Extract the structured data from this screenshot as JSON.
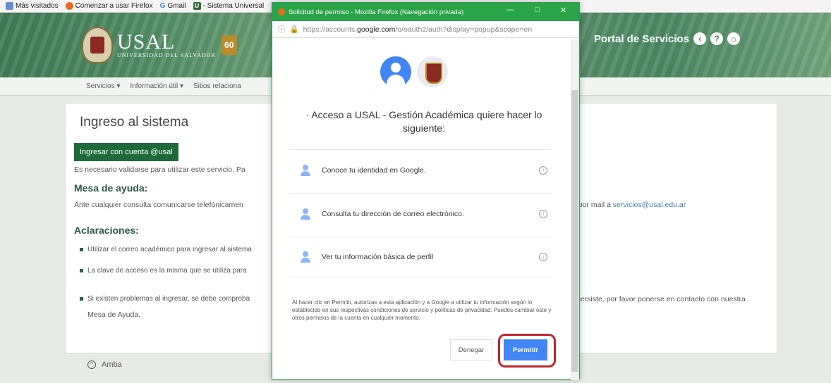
{
  "bookmarks": [
    {
      "label": "Más visitados",
      "icon": "bookmark-icon",
      "color": "#6a8fd0"
    },
    {
      "label": "Comenzar a usar Firefox",
      "icon": "firefox-icon",
      "color": "#e66a1f"
    },
    {
      "label": "Gmail",
      "icon": "google-icon",
      "color": "#4285f4"
    },
    {
      "label": "- Sistema Universal",
      "icon": "u-icon",
      "color": "#2d6a36"
    }
  ],
  "banner": {
    "logo_big": "USAL",
    "logo_small": "UNIVERSIDAD DEL SALVADOR",
    "anniv": "60",
    "portal": "Portal de Servicios"
  },
  "nav": [
    "Servicios ▾",
    "Información útil ▾",
    "Sitios relaciona"
  ],
  "card": {
    "title": "Ingreso al sistema",
    "login_button": "Ingresar con cuenta @usal",
    "validate_text": "Es necesario validarse para utilizar este servicio. Pa",
    "help_heading": "Mesa de ayuda:",
    "help_text_left": "Ante cualquier consulta comunicarse telefónicamen",
    "help_text_right": "o por mail a",
    "help_email": "servicios@usal.edu.ar",
    "notes_heading": "Aclaraciones:",
    "bullets": [
      "Utilizar el correo académico para ingresar al sistema",
      "La clave de acceso es la misma que se utiliza para",
      "Si existen problemas al ingresar, se debe comproba"
    ],
    "bullet3_right": "persiste, por favor ponerse en contacto con nuestra",
    "bullet3_line2": "Mesa de Ayuda."
  },
  "footer_link": "Amba",
  "popup": {
    "title": "Solicitud de permiso - Mozilla Firefox (Navegación privada)",
    "url_prefix": "https://accounts.",
    "url_domain": "google.com",
    "url_rest": "/o/oauth2/auth?display=popup&scope=en",
    "request_text": "· Acceso a USAL - Gestión Académica quiere hacer lo siguiente:",
    "permissions": [
      "Conoce tu identidad en Google.",
      "Consulta tu dirección de correo electrónico.",
      "Ver tu información básica de perfil"
    ],
    "disclaimer": "Al hacer clic en Permitir, autorizas a esta aplicación y a Google a utilizar tu información según lo establecido en sus respectivas condiciones de servicio y políticas de privacidad. Puedes cambiar este y otros permisos de la cuenta en cualquier momento.",
    "deny_label": "Denegar",
    "allow_label": "Permitir"
  }
}
